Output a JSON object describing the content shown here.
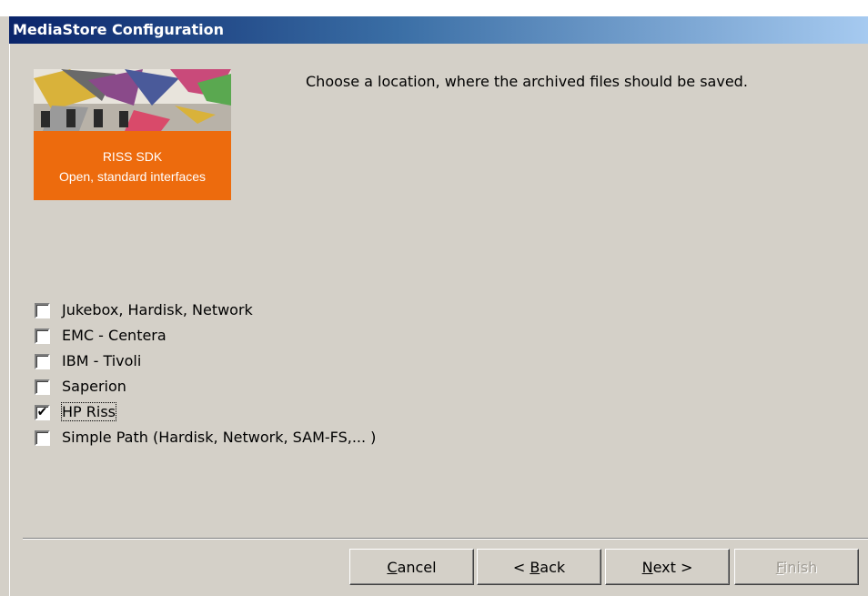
{
  "window": {
    "title": "MediaStore Configuration"
  },
  "logo": {
    "line1": "RISS SDK",
    "line2": "Open, standard interfaces"
  },
  "instruction": "Choose a location, where the archived files should be saved.",
  "options": [
    {
      "label": "Jukebox, Hardisk, Network",
      "checked": false
    },
    {
      "label": "EMC - Centera",
      "checked": false
    },
    {
      "label": "IBM - Tivoli",
      "checked": false
    },
    {
      "label": "Saperion",
      "checked": false
    },
    {
      "label": "HP Riss",
      "checked": true
    },
    {
      "label": "Simple Path (Hardisk, Network, SAM-FS,... )",
      "checked": false
    }
  ],
  "buttons": {
    "cancel": {
      "mnemonic": "C",
      "rest": "ancel"
    },
    "back": {
      "prefix": "< ",
      "mnemonic": "B",
      "rest": "ack"
    },
    "next": {
      "mnemonic": "N",
      "rest": "ext >"
    },
    "finish": {
      "mnemonic": "F",
      "rest": "inish",
      "disabled": true
    }
  },
  "colors": {
    "title_gradient_start": "#0a246a",
    "title_gradient_end": "#a6caf0",
    "logo_band": "#ed6b0d",
    "dialog_face": "#d4d0c8"
  }
}
